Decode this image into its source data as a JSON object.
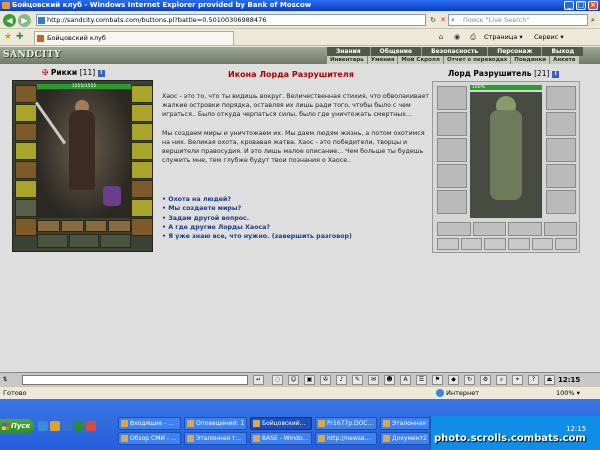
{
  "window": {
    "title": "Бойцовский клуб - Windows Internet Explorer provided by Bank of Moscow",
    "icon": "ie-icon"
  },
  "browser": {
    "url": "http://sandcity.combats.com/buttons.pl?battle=0.50100306988476",
    "search_placeholder": "Поиск \"Live Search\"",
    "tab_title": "Бойцовский клуб",
    "toolbar_right": {
      "page_label": "Страница",
      "service_label": "Сервис"
    },
    "status_text": "Готово",
    "zone_label": "Интернет",
    "zoom": "100%"
  },
  "game": {
    "logo": "SANDCITY",
    "main_menu": [
      "Знания",
      "Общение",
      "Безопасность",
      "Персонаж",
      "Выход"
    ],
    "sub_menu": [
      "Инвентарь",
      "Умения",
      "Мой Скролл",
      "Отчет о переводах",
      "Поединки",
      "Анкета"
    ],
    "player": {
      "name": "Рикки",
      "level": "[11]",
      "hp": "1555/1555"
    },
    "enemy": {
      "name": "Лорд Разрушитель",
      "level": "[21]",
      "hp": "100%"
    },
    "dialog": {
      "title": "Икона Лорда Разрушителя",
      "paragraphs": [
        "Хаос - это то, что ты видишь вокруг. Величественная стихия, что обволакивает жалкие островки порядка, оставляя их лишь ради того, чтобы было с чем играться.. Было откуда черпаться силы, было где уничтожать смертных...",
        "Мы создаем миры и уничтожаем их. Мы даем людям жизнь, а потом охотимся на них. Великая охота, кровавая жатва. Хаос - это победители, творцы и вершители правосудия. И это лишь малое описание... Чем больше ты будешь служить мне, тем глубже будут твои познания о Хаосе.."
      ],
      "choices": [
        "Охота на людей?",
        "Мы создаете миры?",
        "Задам другой вопрос.",
        "А где другие Лорды Хаоса?",
        "Я уже знаю все, что нужно. (завершить разговор)"
      ]
    },
    "clock": "12:15"
  },
  "taskbar": {
    "start_label": "Пуск",
    "buttons": [
      "Входящие - ...",
      "Оповещений: 1",
      "Бойцовский...",
      "Pr1677p.DOC...",
      "Эталонная т...",
      "Обзор СМИ - ...",
      "Эталонная т...",
      "BASE - Windo...",
      "http://newsa...",
      "Документ2 - ..."
    ],
    "time": "12:15"
  },
  "watermark": "photo.scrolls.combats.com"
}
